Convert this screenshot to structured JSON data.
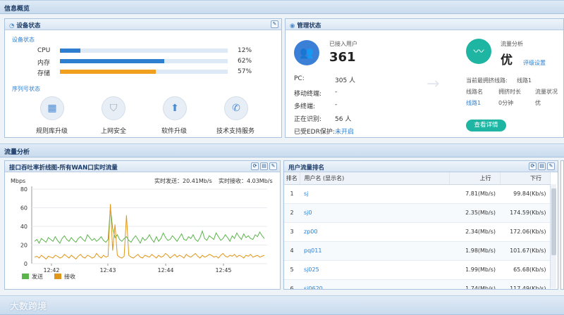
{
  "top_bar": {
    "title": "信息概览"
  },
  "device_status": {
    "title": "设备状态",
    "sub_title": "设备状态",
    "rows": [
      {
        "label": "CPU",
        "value": "12%",
        "percent": 12,
        "color": "#2f7fd1"
      },
      {
        "label": "内存",
        "value": "62%",
        "percent": 62,
        "color": "#2f7fd1"
      },
      {
        "label": "存储",
        "value": "57%",
        "percent": 57,
        "color": "#f0a01e"
      }
    ],
    "serial_title": "序列号状态",
    "icons": [
      {
        "label": "规则库升级",
        "icon": "grid-icon"
      },
      {
        "label": "上网安全",
        "icon": "shield-icon"
      },
      {
        "label": "软件升级",
        "icon": "upload-icon"
      },
      {
        "label": "技术支持服务",
        "icon": "support-icon"
      }
    ]
  },
  "manage_status": {
    "title": "管理状态",
    "users_label": "已接入用户",
    "users_count": "361",
    "details": [
      {
        "label": "PC:",
        "value": "305 人"
      },
      {
        "label": "移动终端:",
        "value": "-"
      },
      {
        "label": "多终端:",
        "value": "-"
      },
      {
        "label": "正在识别:",
        "value": "56 人"
      },
      {
        "label": "已受EDR保护:",
        "value": "未开启"
      }
    ],
    "flow_label": "流量分析",
    "flow_grade": "优",
    "grade_setting": "评级设置",
    "congested_line_label": "当前最拥挤线路:",
    "congested_line_value": "线路1",
    "table_headers": [
      "线路名",
      "拥挤时长",
      "流量状况"
    ],
    "table_row": [
      "线路1",
      "0分钟",
      "优"
    ],
    "detail_button": "查看详情"
  },
  "traffic_bar": {
    "title": "流量分析"
  },
  "throughput": {
    "title": "接口吞吐率折线图-所有WAN口实时流量",
    "unit": "Mbps",
    "send_rate": "实时发送：20.41Mb/s",
    "recv_rate": "实时接收：4.03Mb/s",
    "legend_send": "发送",
    "legend_recv": "接收"
  },
  "chart_data": {
    "type": "line",
    "x": [
      "12:42",
      "12:43",
      "12:44",
      "12:45"
    ],
    "ylim": [
      0,
      80
    ],
    "yticks": [
      0,
      20,
      40,
      60,
      80
    ],
    "series": [
      {
        "name": "发送",
        "color": "#5bb54a",
        "values": [
          24,
          26,
          22,
          27,
          25,
          23,
          28,
          26,
          24,
          29,
          25,
          22,
          27,
          30,
          26,
          24,
          28,
          25,
          23,
          27,
          29,
          26,
          24,
          31,
          28,
          25,
          27,
          24,
          26,
          29,
          25,
          23,
          26,
          60,
          38,
          28,
          31,
          26,
          24,
          27,
          29,
          25,
          23,
          27,
          30,
          26,
          22,
          28,
          25,
          27,
          31,
          26,
          23,
          29,
          24,
          27,
          33,
          28,
          25,
          26,
          30,
          27,
          24,
          28,
          32,
          26,
          25,
          29,
          27,
          31,
          26,
          24,
          28,
          35,
          27,
          25,
          30,
          28,
          26,
          33,
          29,
          25,
          27,
          31,
          28,
          24,
          30,
          27,
          33,
          29,
          26,
          32,
          28,
          30,
          27,
          26,
          31,
          29,
          34,
          30,
          27
        ]
      },
      {
        "name": "接收",
        "color": "#e0961a",
        "values": [
          7,
          8,
          6,
          9,
          7,
          5,
          8,
          7,
          6,
          9,
          8,
          6,
          7,
          10,
          8,
          6,
          9,
          7,
          5,
          8,
          10,
          7,
          6,
          9,
          8,
          6,
          7,
          11,
          8,
          6,
          9,
          7,
          8,
          64,
          14,
          42,
          9,
          7,
          6,
          8,
          52,
          9,
          7,
          6,
          8,
          10,
          7,
          6,
          9,
          8,
          7,
          10,
          8,
          6,
          9,
          7,
          8,
          11,
          9,
          6,
          8,
          10,
          7,
          9,
          8,
          6,
          10,
          8,
          7,
          9,
          11,
          8,
          6,
          9,
          7,
          8,
          10,
          9,
          7,
          8,
          6,
          9,
          11,
          8,
          7,
          9,
          8,
          10,
          7,
          9,
          8,
          6,
          9,
          8,
          10,
          7,
          8,
          9,
          7,
          8,
          9
        ]
      }
    ]
  },
  "user_rank": {
    "title": "用户流量排名",
    "headers": [
      "排名",
      "用户名 (显示名)",
      "上行",
      "下行"
    ],
    "rows": [
      {
        "rank": "1",
        "name": "sj",
        "up": "7.81(Mb/s)",
        "down": "99.84(Kb/s)"
      },
      {
        "rank": "2",
        "name": "sj0",
        "up": "2.35(Mb/s)",
        "down": "174.59(Kb/s)"
      },
      {
        "rank": "3",
        "name": "zp00",
        "up": "2.34(Mb/s)",
        "down": "172.06(Kb/s)"
      },
      {
        "rank": "4",
        "name": "pq011",
        "up": "1.98(Mb/s)",
        "down": "101.67(Kb/s)"
      },
      {
        "rank": "5",
        "name": "sj025",
        "up": "1.99(Mb/s)",
        "down": "65.68(Kb/s)"
      },
      {
        "rank": "6",
        "name": "sj0620",
        "up": "1.74(Mb/s)",
        "down": "117.49(Kb/s)"
      }
    ]
  },
  "footer": {
    "watermark": "大数跨境"
  }
}
